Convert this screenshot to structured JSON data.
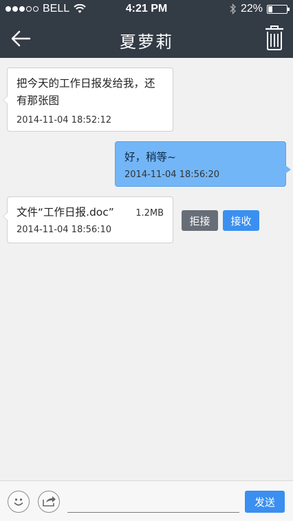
{
  "status_bar": {
    "carrier": "BELL",
    "time": "4:21 PM",
    "battery": "22%",
    "battery_level": 0.22,
    "signal_strength": 3,
    "signal_max": 5
  },
  "nav": {
    "title": "夏萝莉",
    "back_icon": "back-arrow-icon",
    "delete_icon": "trash-icon"
  },
  "messages": [
    {
      "direction": "in",
      "text": "把今天的工作日报发给我，还有那张图",
      "line1": "把今天的工作日报发给我，还",
      "line2": "有那张图",
      "time": "2014-11-04 18:52:12"
    },
    {
      "direction": "out",
      "text": "好，稍等~",
      "time": "2014-11-04 18:56:20"
    },
    {
      "direction": "in",
      "type": "file",
      "text": "文件“工作日报.doc”",
      "size": "1.2MB",
      "time": "2014-11-04 18:56:10",
      "reject_label": "拒接",
      "accept_label": "接收"
    }
  ],
  "input_bar": {
    "emoji_icon": "smiley-icon",
    "share_icon": "share-arrow-icon",
    "input_value": "",
    "send_label": "发送"
  },
  "colors": {
    "bar_bg": "#333b45",
    "bg": "#f1f1f1",
    "out_bubble": "#73b6f7",
    "accent": "#3a8ff0",
    "reject": "#686e78"
  }
}
